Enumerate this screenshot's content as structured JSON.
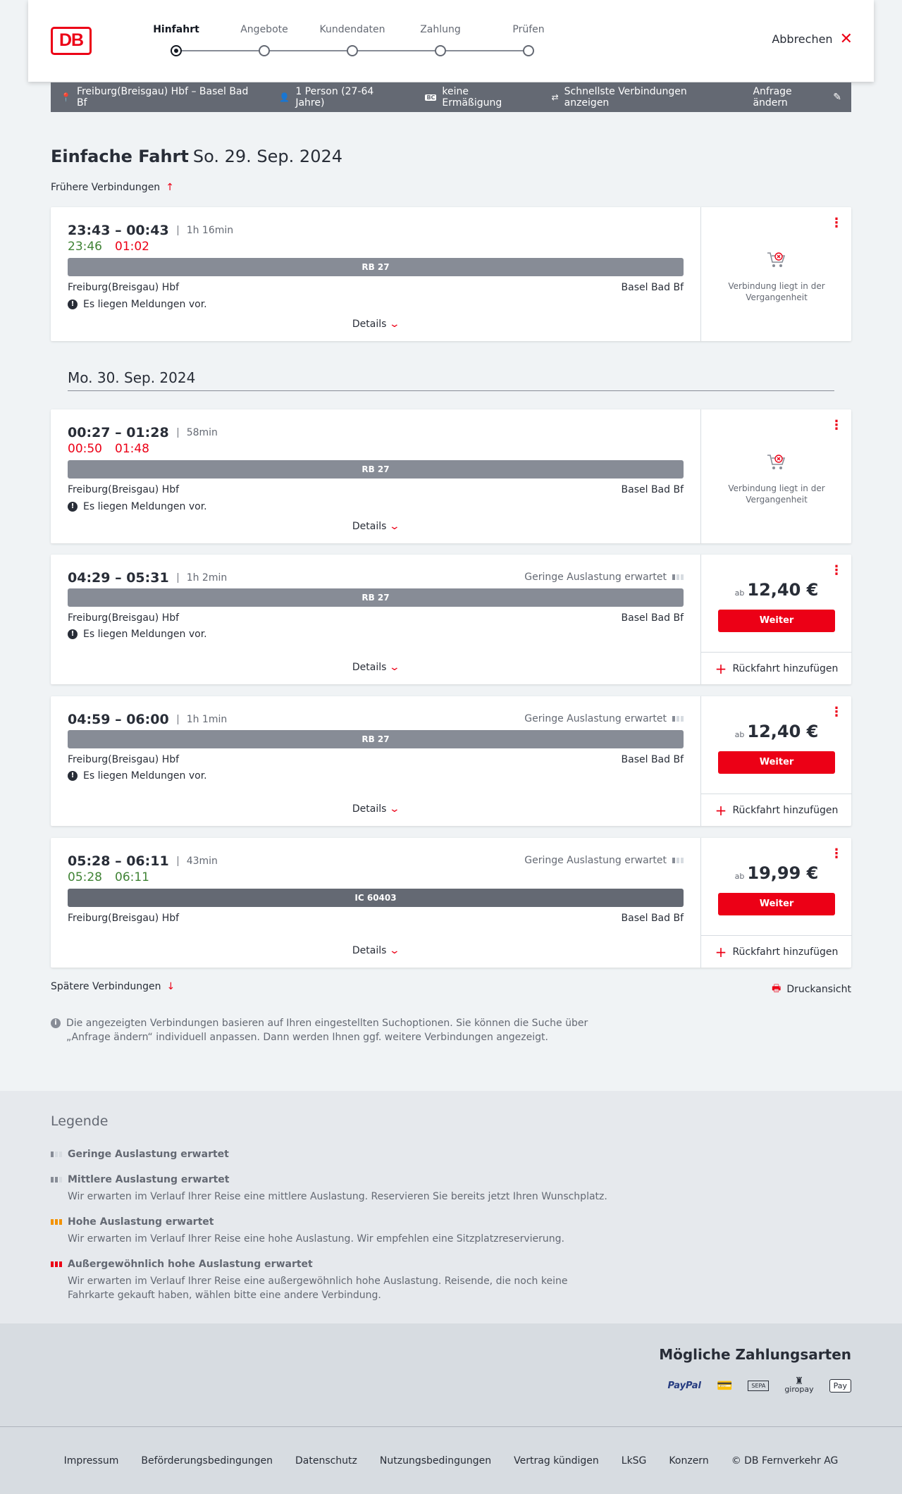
{
  "header": {
    "logo_text": "DB",
    "steps": [
      "Hinfahrt",
      "Angebote",
      "Kundendaten",
      "Zahlung",
      "Prüfen"
    ],
    "active_step": 0,
    "cancel_label": "Abbrechen"
  },
  "summary": {
    "route": "Freiburg(Breisgau) Hbf – Basel Bad Bf",
    "passengers": "1 Person (27-64 Jahre)",
    "discount": "keine Ermäßigung",
    "fastest": "Schnellste Verbindungen anzeigen",
    "edit_label": "Anfrage ändern"
  },
  "headline": {
    "title": "Einfache Fahrt",
    "date": "So. 29. Sep. 2024",
    "earlier": "Frühere Verbindungen",
    "date2": "Mo. 30. Sep. 2024",
    "later": "Spätere Verbindungen",
    "print": "Druckansicht"
  },
  "connections": [
    {
      "times": "23:43 – 00:43",
      "duration": "1h 16min",
      "rt_dep": "23:46",
      "rt_arr": "01:02",
      "train": "RB 27",
      "from": "Freiburg(Breisgau) Hbf",
      "to": "Basel Bad Bf",
      "message": "Es liegen Meldungen vor.",
      "details": "Details",
      "past_text": "Verbindung liegt in der Vergangenheit"
    },
    {
      "times": "00:27 – 01:28",
      "duration": "58min",
      "rt_dep": "00:50",
      "rt_arr": "01:48",
      "train": "RB 27",
      "from": "Freiburg(Breisgau) Hbf",
      "to": "Basel Bad Bf",
      "message": "Es liegen Meldungen vor.",
      "details": "Details",
      "past_text": "Verbindung liegt in der Vergangenheit"
    },
    {
      "times": "04:29 – 05:31",
      "duration": "1h 2min",
      "utilization": "Geringe Auslastung erwartet",
      "train": "RB 27",
      "from": "Freiburg(Breisgau) Hbf",
      "to": "Basel Bad Bf",
      "message": "Es liegen Meldungen vor.",
      "details": "Details",
      "price_prefix": "ab",
      "price": "12,40 €",
      "button": "Weiter",
      "return": "Rückfahrt hinzufügen"
    },
    {
      "times": "04:59 – 06:00",
      "duration": "1h 1min",
      "utilization": "Geringe Auslastung erwartet",
      "train": "RB 27",
      "from": "Freiburg(Breisgau) Hbf",
      "to": "Basel Bad Bf",
      "message": "Es liegen Meldungen vor.",
      "details": "Details",
      "price_prefix": "ab",
      "price": "12,40 €",
      "button": "Weiter",
      "return": "Rückfahrt hinzufügen"
    },
    {
      "times": "05:28 – 06:11",
      "duration": "43min",
      "rt_dep": "05:28",
      "rt_arr": "06:11",
      "utilization": "Geringe Auslastung erwartet",
      "train": "IC 60403",
      "from": "Freiburg(Breisgau) Hbf",
      "to": "Basel Bad Bf",
      "details": "Details",
      "price_prefix": "ab",
      "price": "19,99 €",
      "button": "Weiter",
      "return": "Rückfahrt hinzufügen"
    }
  ],
  "info_text": "Die angezeigten Verbindungen basieren auf Ihren eingestellten Suchoptionen. Sie können die Suche über „Anfrage ändern“ individuell anpassen. Dann werden Ihnen ggf. weitere Verbindungen angezeigt.",
  "legend": {
    "title": "Legende",
    "items": [
      {
        "title": "Geringe Auslastung erwartet",
        "desc": ""
      },
      {
        "title": "Mittlere Auslastung erwartet",
        "desc": "Wir erwarten im Verlauf Ihrer Reise eine mittlere Auslastung. Reservieren Sie bereits jetzt Ihren Wunschplatz."
      },
      {
        "title": "Hohe Auslastung erwartet",
        "desc": "Wir erwarten im Verlauf Ihrer Reise eine hohe Auslastung. Wir empfehlen eine Sitzplatzreservierung."
      },
      {
        "title": "Außergewöhnlich hohe Auslastung erwartet",
        "desc": "Wir erwarten im Verlauf Ihrer Reise eine außergewöhnlich hohe Auslastung. Reisende, die noch keine Fahrkarte gekauft haben, wählen bitte eine andere Verbindung."
      }
    ]
  },
  "payment": {
    "title": "Mögliche Zahlungsarten",
    "paypal": "PayPal",
    "sepa": "SEPA",
    "giropay": "giropay",
    "applepay": "Pay"
  },
  "footer": [
    "Impressum",
    "Beförderungsbedingungen",
    "Datenschutz",
    "Nutzungsbedingungen",
    "Vertrag kündigen",
    "LkSG",
    "Konzern",
    "© DB Fernverkehr AG"
  ],
  "colors": {
    "accent": "#ec0016",
    "delay_ok": "#408335",
    "bar": "#646973"
  }
}
